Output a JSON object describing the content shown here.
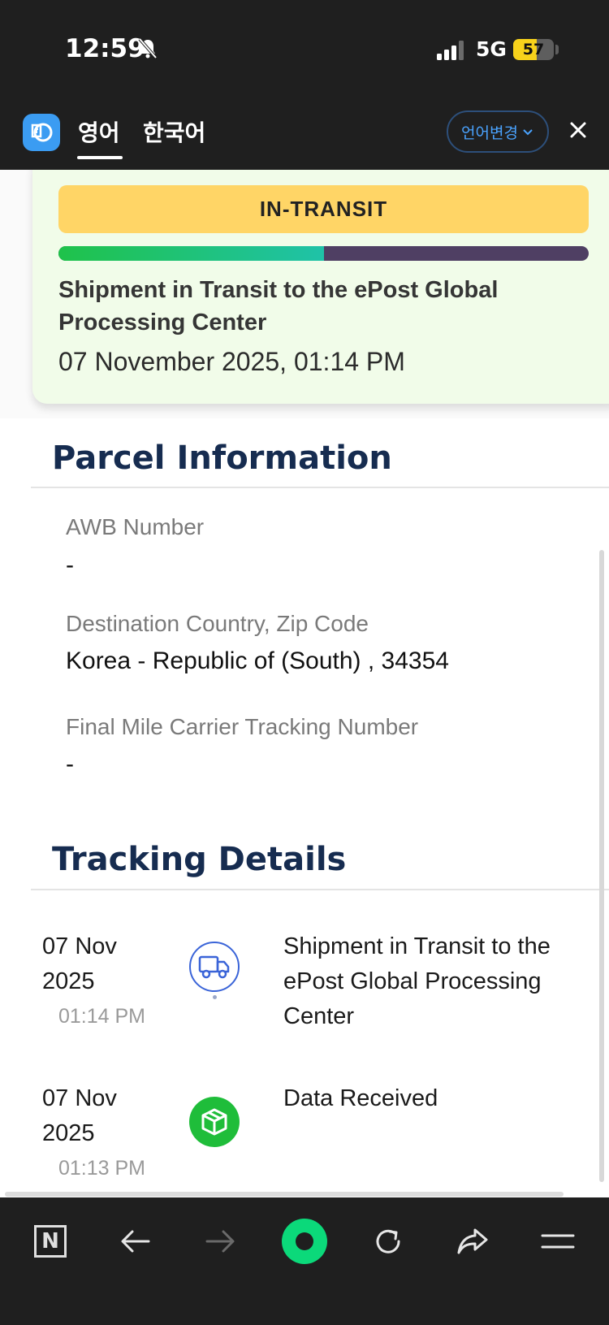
{
  "status_bar": {
    "time": "12:59",
    "network": "5G",
    "battery_level": "57",
    "battery_fraction": 0.57,
    "icons": [
      "bell-slash-icon",
      "signal-icon"
    ]
  },
  "translate_bar": {
    "tabs": [
      {
        "label": "영어",
        "active": true
      },
      {
        "label": "한국어",
        "active": false
      }
    ],
    "change_language_label": "언어변경",
    "icons": [
      "translate-logo-icon",
      "chevron-down-icon",
      "close-icon"
    ]
  },
  "status_card": {
    "status": "IN-TRANSIT",
    "progress_percent": 50,
    "title": "Shipment in Transit to the ePost Global Processing Center",
    "date": "07 November 2025, 01:14 PM"
  },
  "parcel_info": {
    "heading": "Parcel Information",
    "fields": [
      {
        "label": "AWB Number",
        "value": "-"
      },
      {
        "label": "Destination Country, Zip Code",
        "value": "Korea - Republic of (South) , 34354"
      },
      {
        "label": "Final Mile Carrier Tracking Number",
        "value": "-"
      }
    ]
  },
  "tracking": {
    "heading": "Tracking Details",
    "events": [
      {
        "date": "07 Nov 2025",
        "time": "01:14 PM",
        "description": "Shipment in Transit to the ePost Global Processing Center",
        "icon": "truck-icon"
      },
      {
        "date": "07 Nov 2025",
        "time": "01:13 PM",
        "description": "Data Received",
        "icon": "box-icon"
      }
    ]
  },
  "bottom_nav": {
    "logo_letter": "N",
    "icons": [
      "n-logo-icon",
      "back-arrow-icon",
      "forward-arrow-icon",
      "home-icon",
      "reload-icon",
      "share-icon",
      "menu-icon"
    ]
  },
  "colors": {
    "status_pill": "#ffd566",
    "card_bg": "#f1fce9",
    "heading": "#162c50",
    "accent_green": "#1fbd3a",
    "progress_track": "#4f3f63"
  }
}
